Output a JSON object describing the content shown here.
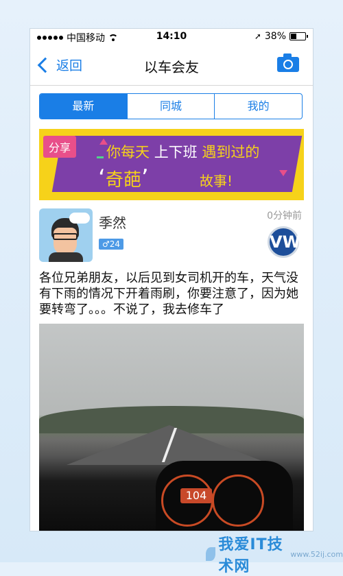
{
  "status_bar": {
    "carrier": "中国移动",
    "time": "14:10",
    "battery": "38%",
    "battery_level": 0.38
  },
  "nav": {
    "back_label": "返回",
    "title": "以车会友",
    "camera_icon": "camera-icon"
  },
  "tabs": [
    {
      "label": "最新",
      "selected": true
    },
    {
      "label": "同城",
      "selected": false
    },
    {
      "label": "我的",
      "selected": false
    }
  ],
  "banner": {
    "share": "分享",
    "line1_a": "你每天",
    "line1_b": "上下班",
    "line1_c": "遇到过的",
    "quote_open": "‘",
    "highlight": "奇葩",
    "quote_close": "’",
    "line3": "故事!",
    "colors": {
      "background": "#f6d21a",
      "band": "#7d3fa8",
      "tag": "#e84f8a"
    }
  },
  "post": {
    "author": "季然",
    "gender_badge": "♂24",
    "time_ago": "0分钟前",
    "car_brand_logo": "VW",
    "text": "各位兄弟朋友，以后见到女司机开的车，天气没有下雨的情况下开着雨刷，你要注意了，因为她要转弯了。。。不说了，我去修车了",
    "speedometer": "104"
  },
  "watermark": {
    "logo": "我爱IT技术网",
    "url": "www.52ij.com"
  },
  "colors": {
    "accent": "#1a7ee6"
  }
}
